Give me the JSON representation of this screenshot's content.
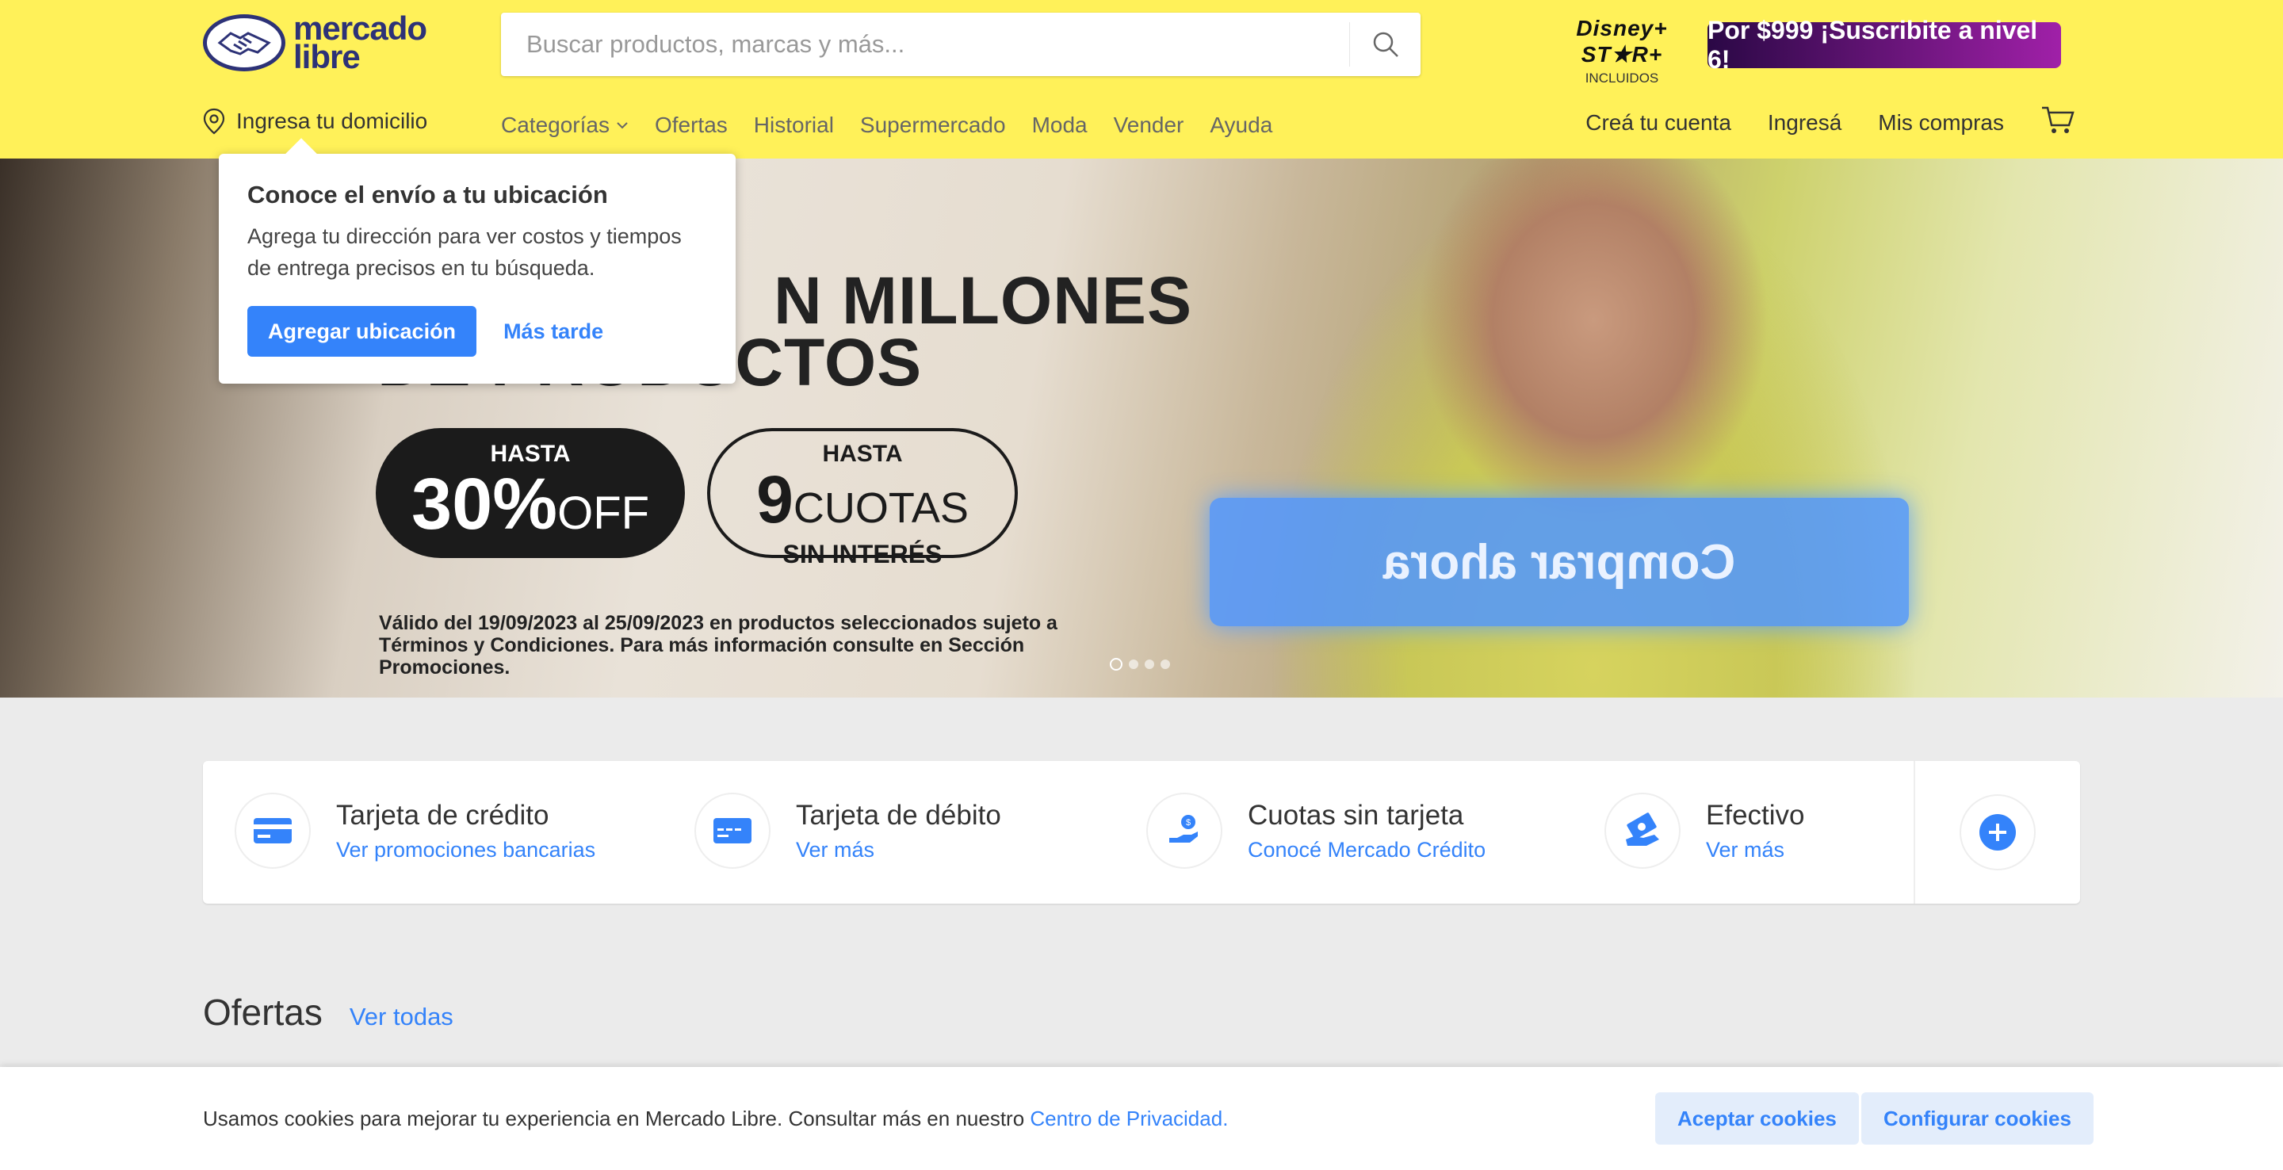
{
  "header": {
    "logo": {
      "line1": "mercado",
      "line2": "libre"
    },
    "search": {
      "placeholder": "Buscar productos, marcas y más..."
    },
    "disney": {
      "brand": "Disney+ ST★R+",
      "sub": "INCLUIDOS"
    },
    "promo_label": "Por $999 ¡Suscribite a nivel 6!",
    "location_label": "Ingresa tu domicilio",
    "nav": [
      "Categorías",
      "Ofertas",
      "Historial",
      "Supermercado",
      "Moda",
      "Vender",
      "Ayuda"
    ],
    "user_nav": [
      "Creá tu cuenta",
      "Ingresá",
      "Mis compras"
    ]
  },
  "popover": {
    "title": "Conoce el envío a tu ubicación",
    "text": "Agrega tu dirección para ver costos y tiempos de entrega precisos en tu búsqueda.",
    "primary": "Agregar ubicación",
    "secondary": "Más tarde"
  },
  "hero": {
    "title_line1": "N MILLONES",
    "title_line2": "DE PRODUCTOS",
    "badge1": {
      "top": "HASTA",
      "big": "30%",
      "small": "OFF"
    },
    "badge2": {
      "top": "HASTA",
      "big": "9",
      "small": "CUOTAS",
      "bottom": "SIN INTERÉS"
    },
    "legal_line1": "Válido del 19/09/2023 al 25/09/2023 en productos seleccionados sujeto a",
    "legal_line2": "Términos y Condiciones. Para más información consulte en Sección Promociones.",
    "cta": "Comprar ahora",
    "slides": 4,
    "active_slide": 1
  },
  "payments": [
    {
      "title": "Tarjeta de crédito",
      "link": "Ver promociones bancarias",
      "icon": "credit-card-icon"
    },
    {
      "title": "Tarjeta de débito",
      "link": "Ver más",
      "icon": "debit-card-icon"
    },
    {
      "title": "Cuotas sin tarjeta",
      "link": "Conocé Mercado Crédito",
      "icon": "hand-coin-icon"
    },
    {
      "title": "Efectivo",
      "link": "Ver más",
      "icon": "cash-icon"
    }
  ],
  "offers": {
    "title": "Ofertas",
    "link": "Ver todas"
  },
  "cookie": {
    "text": "Usamos cookies para mejorar tu experiencia en Mercado Libre. Consultar más en nuestro ",
    "link": "Centro de Privacidad.",
    "accept": "Aceptar cookies",
    "configure": "Configurar cookies"
  },
  "colors": {
    "header_bg": "#fff159",
    "accent": "#3483fa",
    "promo_from": "#2a0845",
    "promo_to": "#a020a8"
  }
}
